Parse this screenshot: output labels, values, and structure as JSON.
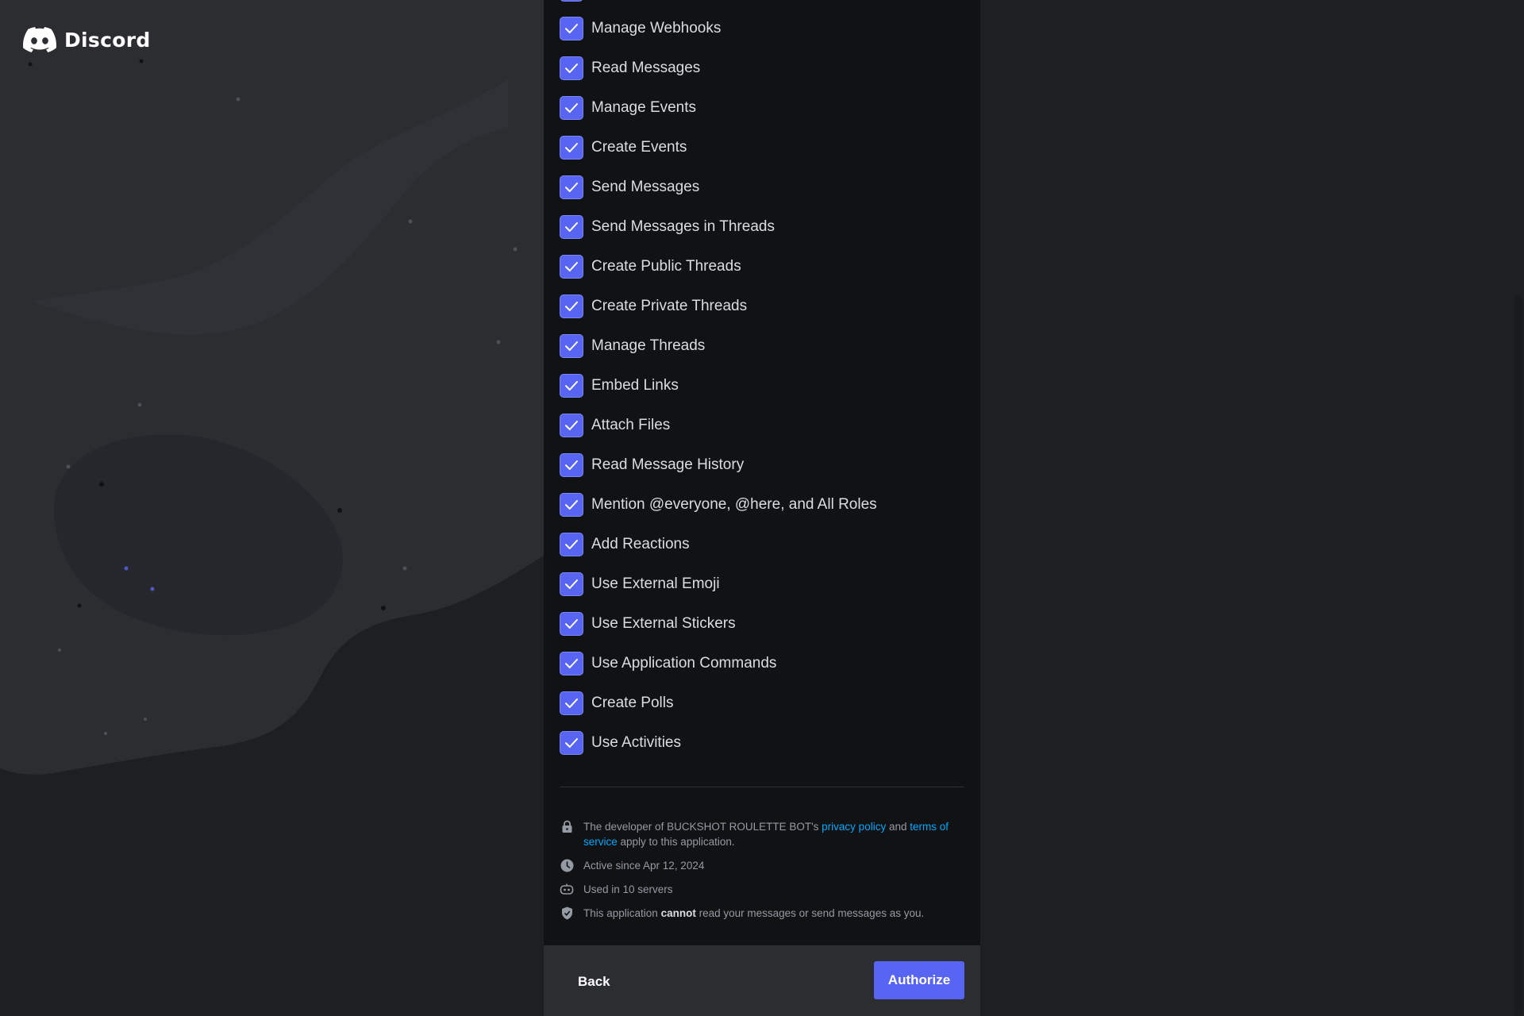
{
  "brand": {
    "logo_text": "Discord"
  },
  "permissions": [
    "Manage Webhooks",
    "Read Messages",
    "Manage Events",
    "Create Events",
    "Send Messages",
    "Send Messages in Threads",
    "Create Public Threads",
    "Create Private Threads",
    "Manage Threads",
    "Embed Links",
    "Attach Files",
    "Read Message History",
    "Mention @everyone, @here, and All Roles",
    "Add Reactions",
    "Use External Emoji",
    "Use External Stickers",
    "Use Application Commands",
    "Create Polls",
    "Use Activities"
  ],
  "permission_checked": true,
  "info": {
    "policy_prefix": "The developer of BUCKSHOT ROULETTE BOT's ",
    "privacy_link": "privacy policy",
    "and": " and ",
    "terms_link": "terms of service",
    "policy_suffix": " apply to this application.",
    "active_since": "Active since Apr 12, 2024",
    "used_in": "Used in 10 servers",
    "cannot_prefix": "This application ",
    "cannot_word": "cannot",
    "cannot_suffix": " read your messages or send messages as you."
  },
  "footer": {
    "back_label": "Back",
    "authorize_label": "Authorize"
  },
  "colors": {
    "accent": "#5865f2",
    "link": "#00a8fc",
    "panel": "#111214",
    "footer": "#2b2d31"
  }
}
